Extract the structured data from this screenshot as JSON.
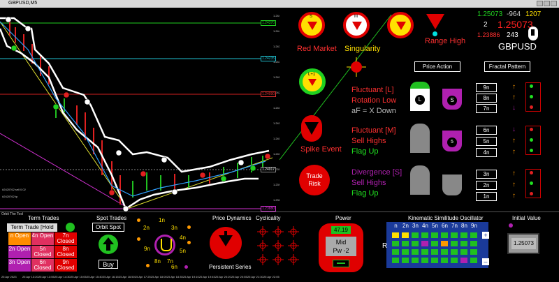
{
  "window": {
    "title": "GBPUSD,M5"
  },
  "chart": {
    "symbol_labels": [
      "#2420762 sell 0.02",
      "#2420762 tp"
    ],
    "price_levels": [
      "1.24370",
      "1.24235",
      "1.24090",
      "1.24017",
      "1.23880"
    ],
    "price_axis": [
      "1.24450",
      "1.24400",
      "1.24350",
      "1.24300",
      "1.24250",
      "1.24200",
      "1.24150",
      "1.24100",
      "1.24050",
      "1.24000",
      "1.23950",
      "1.23900",
      "1.23850"
    ],
    "time_axis": [
      "25 Apr 2023",
      "25 Apr 13:20",
      "25 Apr 13:55",
      "25 Apr 14:30",
      "25 Apr 15:05",
      "25 Apr 15:40",
      "25 Apr 16:15",
      "25 Apr 16:50",
      "25 Apr 17:25",
      "25 Apr 18:00",
      "25 Apr 18:35",
      "25 Apr 19:10",
      "25 Apr 19:45",
      "25 Apr 20:20",
      "25 Apr 20:55",
      "25 Apr 21:30",
      "25 Apr 22:05"
    ]
  },
  "panel": {
    "prices": {
      "bid": "1.25073",
      "spread": "-964",
      "ask_small": "1207",
      "count": "2",
      "current": "1.25073",
      "low": "1.23886",
      "low_count": "243"
    },
    "symbol": "GBPUSD",
    "signals": {
      "red_market": {
        "label": "Red Market",
        "letter": "S"
      },
      "singularity": {
        "label": "Singularity",
        "letter": "M"
      },
      "range_high": {
        "label": "Range High"
      },
      "l_plus": {
        "letter": "L+1"
      },
      "spike_event": {
        "label": "Spike Event"
      },
      "trade_risk": {
        "label": "Trade Risk"
      }
    },
    "price_action_btn": "Price Action",
    "fractal_btn": "Fractal Pattern",
    "groups": [
      {
        "line1": "Fluctuant [L]",
        "line2": "Rotation Low",
        "line3": "aF = X Down",
        "color": "#ff3030",
        "badge": "L",
        "rows": [
          "9n",
          "8n",
          "7n"
        ]
      },
      {
        "line1": "Fluctuant [M]",
        "line2": "Sell Highs",
        "line3": "Flag Up",
        "color": "#ff3030",
        "badge": "5",
        "rows": [
          "6n",
          "5n",
          "4n"
        ]
      },
      {
        "line1": "Divergence [S]",
        "line2": "Sell Highs",
        "line3": "Flag Up",
        "color": "#b020b0",
        "badge": "",
        "rows": [
          "3n",
          "2n",
          "1n"
        ]
      }
    ]
  },
  "bottom": {
    "orbit_label": "Orbit The Tool",
    "term_trades": {
      "title": "Term Trades",
      "button": "Term Trade [Hold",
      "cells": [
        {
          "text": "n Open",
          "bg": "#ff8c00"
        },
        {
          "text": "4n Open",
          "bg": "#e03060"
        },
        {
          "text": "7n Closed",
          "bg": "#e00000"
        },
        {
          "text": "2n Open",
          "bg": "#b020b0"
        },
        {
          "text": "5n Closed",
          "bg": "#e03060"
        },
        {
          "text": "8n Closed",
          "bg": "#e00000"
        },
        {
          "text": "3n Open",
          "bg": "#b020b0"
        },
        {
          "text": "6n Closed",
          "bg": "#e03060"
        },
        {
          "text": "9n Closed",
          "bg": "#e00000"
        }
      ]
    },
    "spot_trades": {
      "title": "Spot Trades",
      "button": "Orbit Spot",
      "buy": "Buy"
    },
    "orbit": {
      "labels": [
        "1n",
        "2n",
        "3n",
        "9n",
        "4n",
        "8n",
        "5n",
        "7n",
        "6n"
      ]
    },
    "price_dynamics": {
      "title": "Price Dynamics",
      "label": "Persistent Series"
    },
    "cyclicality": {
      "title": "Cyclicality"
    },
    "power": {
      "title": "Power",
      "value": "47.19",
      "box_line1": "Mid",
      "box_line2": "Pw -2"
    },
    "kso": {
      "title": "Kinematic Similitude Oscillator",
      "headers": [
        "n",
        "2n",
        "3n",
        "4n",
        "5n",
        "6n",
        "7n",
        "8n",
        "9n"
      ],
      "left_label": "R"
    },
    "initial_value": {
      "title": "Initial Value",
      "value": "1.25073"
    }
  }
}
